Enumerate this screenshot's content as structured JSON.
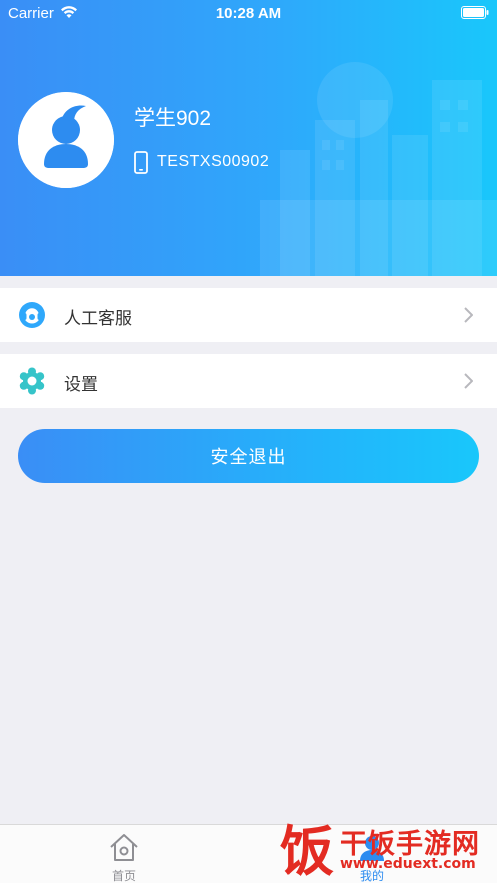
{
  "status_bar": {
    "carrier": "Carrier",
    "time": "10:28 AM",
    "icons": [
      "wifi-icon",
      "battery-icon"
    ]
  },
  "profile": {
    "name": "学生902",
    "account": "TESTXS00902",
    "avatar_icon": "user-avatar-icon",
    "account_icon": "phone-icon"
  },
  "menu": [
    {
      "label": "人工客服",
      "icon": "customer-service-icon",
      "icon_color": "#2fa8fb"
    },
    {
      "label": "设置",
      "icon": "settings-gear-icon",
      "icon_color": "#36c4c9"
    }
  ],
  "logout": {
    "label": "安全退出"
  },
  "tab_bar": {
    "tabs": [
      {
        "label": "首页",
        "icon": "home-icon",
        "active": false
      },
      {
        "label": "我的",
        "icon": "profile-icon",
        "active": true
      }
    ]
  },
  "watermark": {
    "char": "饭",
    "title": "干饭手游网",
    "url": "www.eduext.com"
  },
  "colors": {
    "header_start": "#3a8ef6",
    "header_end": "#19c7fb",
    "background": "#efeff4",
    "active_tab": "#2d8cf0",
    "watermark": "#e32b22"
  }
}
